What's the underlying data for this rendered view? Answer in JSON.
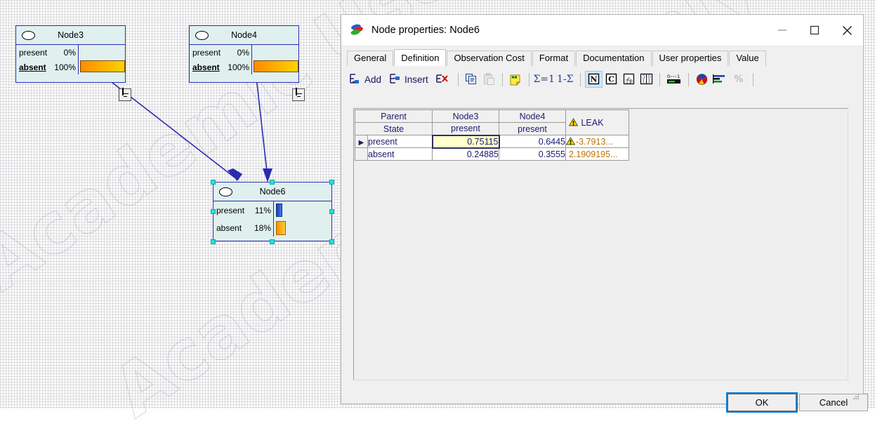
{
  "canvas": {
    "watermark_text": "Academic Use Only",
    "nodes": [
      {
        "id": "node3",
        "title": "Node3",
        "icon": "ellipse-node-icon",
        "states": [
          {
            "name": "present",
            "pct": "0%",
            "bold": false
          },
          {
            "name": "absent",
            "pct": "100%",
            "bold": true
          }
        ]
      },
      {
        "id": "node4",
        "title": "Node4",
        "icon": "ellipse-node-icon",
        "states": [
          {
            "name": "present",
            "pct": "0%",
            "bold": false
          },
          {
            "name": "absent",
            "pct": "100%",
            "bold": true
          }
        ]
      },
      {
        "id": "node6",
        "title": "Node6",
        "icon": "ellipse-node-icon",
        "selected": true,
        "states": [
          {
            "name": "present",
            "pct": "11%",
            "bold": false
          },
          {
            "name": "absent",
            "pct": "18%",
            "bold": false
          }
        ]
      }
    ]
  },
  "dialog": {
    "title": "Node properties: Node6",
    "app_icon": "genie-app-icon",
    "window_buttons": {
      "minimize": "minimize-icon",
      "maximize": "maximize-icon",
      "close": "close-icon"
    },
    "tabs": [
      {
        "label": "General",
        "active": false
      },
      {
        "label": "Definition",
        "active": true
      },
      {
        "label": "Observation Cost",
        "active": false
      },
      {
        "label": "Format",
        "active": false
      },
      {
        "label": "Documentation",
        "active": false
      },
      {
        "label": "User properties",
        "active": false
      },
      {
        "label": "Value",
        "active": false
      }
    ],
    "toolbar": {
      "add_label": "Add",
      "insert_label": "Insert",
      "delete_label": "",
      "buttons": [
        {
          "name": "add-row-button",
          "label": "Add"
        },
        {
          "name": "insert-row-button",
          "label": "Insert"
        },
        {
          "name": "delete-row-button",
          "label": ""
        },
        {
          "name": "copy-button",
          "label": ""
        },
        {
          "name": "paste-button",
          "label": ""
        },
        {
          "name": "note-button",
          "label": ""
        },
        {
          "name": "normalize-sum-button",
          "label": "Σ=1"
        },
        {
          "name": "complement-button",
          "label": "1-Σ"
        },
        {
          "name": "noisy-max-n-button",
          "label": "N"
        },
        {
          "name": "noisy-max-c-button",
          "label": "C"
        },
        {
          "name": "cpt-button",
          "label": "cp"
        },
        {
          "name": "fraction-button",
          "label": "3/0"
        },
        {
          "name": "range-button",
          "label": "0...1"
        },
        {
          "name": "pie-chart-button",
          "label": ""
        },
        {
          "name": "bar-chart-button",
          "label": ""
        },
        {
          "name": "percent-button",
          "label": "%"
        }
      ]
    },
    "table": {
      "header_rows": [
        {
          "label": "Parent",
          "cells": [
            "Node3",
            "Node4",
            "LEAK"
          ]
        },
        {
          "label": "State",
          "cells": [
            "present",
            "present",
            ""
          ]
        }
      ],
      "rows": [
        {
          "selected": true,
          "state": "present",
          "values": [
            "0.75115",
            "0.6445"
          ],
          "leak": "-3.7913...",
          "leak_warning": true
        },
        {
          "selected": false,
          "state": "absent",
          "values": [
            "0.24885",
            "0.3555"
          ],
          "leak": "2.1909195...",
          "leak_warning": false
        }
      ],
      "selected_cell": "0.75115"
    },
    "footer": {
      "ok_label": "OK",
      "cancel_label": "Cancel"
    }
  },
  "colors": {
    "accent": "#0a7cd6",
    "node_fill": "#dff0ef",
    "node_border": "#2b2bb0",
    "bar_orange": "#ff8b00",
    "bar_yellow": "#ffd200",
    "bar_blue": "#2b5cd0",
    "selection_handle": "#27e0e0",
    "selected_cell": "#ffffcc",
    "leak_text": "#c07000",
    "grid_text": "#1b1b6e"
  }
}
